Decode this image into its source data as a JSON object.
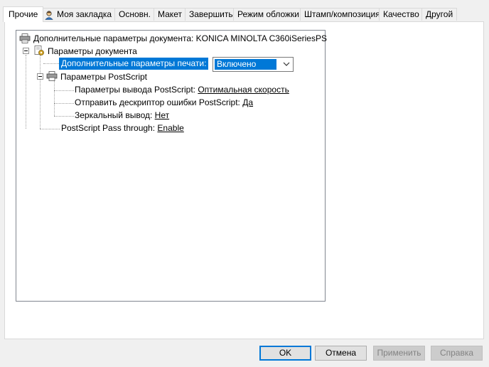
{
  "tabs": [
    {
      "label": "Прочие",
      "active": true
    },
    {
      "label": "Моя закладка",
      "icon": "user-icon"
    },
    {
      "label": "Основн."
    },
    {
      "label": "Макет"
    },
    {
      "label": "Завершить"
    },
    {
      "label": "Режим обложки"
    },
    {
      "label": "Штамп/композиция"
    },
    {
      "label": "Качество"
    },
    {
      "label": "Другой"
    }
  ],
  "tree": {
    "root_label": "Дополнительные параметры документа: KONICA MINOLTA C360iSeriesPS",
    "doc_params_label": "Параметры документа",
    "advanced_print_label": "Дополнительные параметры печати:",
    "advanced_print_value": "Включено",
    "postscript_label": "Параметры PostScript",
    "ps_output_label": "Параметры вывода PostScript:",
    "ps_output_value": "Оптимальная скорость",
    "ps_error_label": "Отправить дескриптор ошибки PostScript:",
    "ps_error_value": "Да",
    "mirror_label": "Зеркальный вывод:",
    "mirror_value": "Нет",
    "passthrough_label": "PostScript Pass through:",
    "passthrough_value": "Enable"
  },
  "buttons": {
    "ok": "OK",
    "cancel": "Отмена",
    "apply": "Применить",
    "help": "Справка"
  },
  "colors": {
    "selection": "#0078d7",
    "default_button_border": "#0078d7"
  }
}
